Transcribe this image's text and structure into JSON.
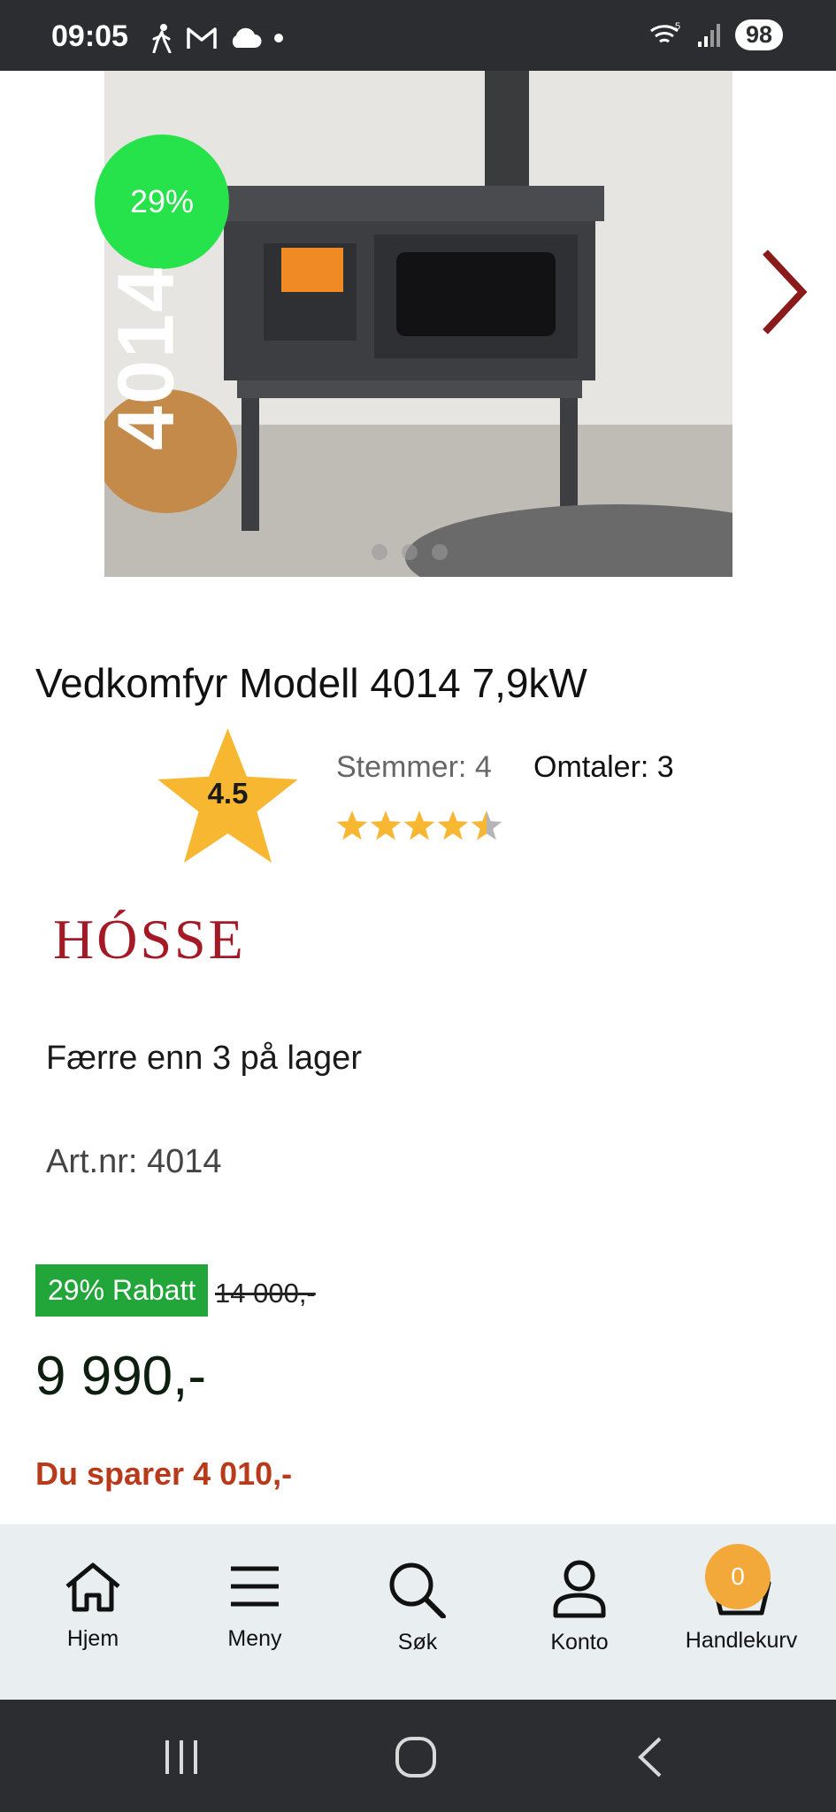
{
  "status_bar": {
    "time": "09:05",
    "battery": "98",
    "wifi_label": "5"
  },
  "gallery": {
    "discount_badge": "29%",
    "model_overlay": "4014",
    "slide_count": 3
  },
  "product": {
    "title": "Vedkomfyr Modell 4014 7,9kW",
    "rating_value": "4.5",
    "votes_label": "Stemmer:",
    "votes_count": "4",
    "reviews_text": "Omtaler: 3",
    "rating_stars": 4.5,
    "brand": "HÓSSE",
    "stock_text": "Færre enn 3 på lager",
    "artnr_text": "Art.nr: 4014"
  },
  "pricing": {
    "discount_label": "29% Rabatt",
    "old_price": "14 000,-",
    "price": "9 990,-",
    "savings": "Du sparer 4 010,-"
  },
  "bottom_nav": {
    "items": [
      {
        "label": "Hjem",
        "icon": "home-icon"
      },
      {
        "label": "Meny",
        "icon": "menu-icon"
      },
      {
        "label": "Søk",
        "icon": "search-icon"
      },
      {
        "label": "Konto",
        "icon": "user-icon"
      },
      {
        "label": "Handlekurv",
        "icon": "basket-icon"
      }
    ],
    "cart_count": "0"
  },
  "colors": {
    "accent_green": "#22a63a",
    "badge_green": "#27e34b",
    "savings_red": "#b83a1a",
    "brand_red": "#a51826",
    "star_yellow": "#f7b731",
    "cart_badge": "#f3a83a"
  }
}
